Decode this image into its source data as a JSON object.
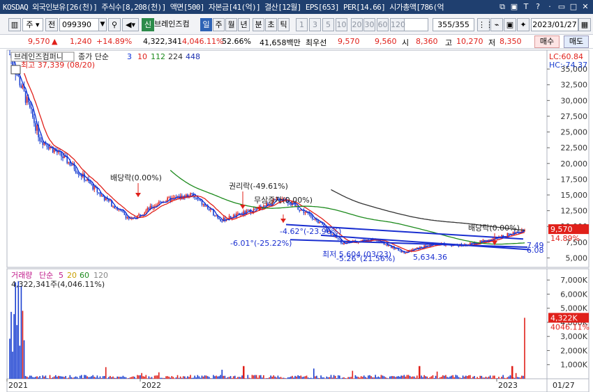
{
  "titlebar": {
    "text": "KOSDAQ 외국인보유[26(천)] 주식수[8,208(천)] 액면[500] 자본금[41(억)] 결산[12월] EPS[653] PER[14.66] 시가총액[786(억"
  },
  "toolbar": {
    "direction": "주",
    "mode": "전",
    "code": "099390",
    "company": "브레인즈컴",
    "periods": [
      "일",
      "주",
      "월",
      "년",
      "분",
      "초",
      "틱"
    ],
    "active_period": "일",
    "intervals": [
      "1",
      "3",
      "5",
      "10",
      "20",
      "30",
      "60",
      "120"
    ],
    "count": "355/355",
    "date": "2023/01/27"
  },
  "pricerow": {
    "price": "9,570",
    "change": "1,240",
    "change_pct": "+14.89%",
    "volume": "4,322,341",
    "volume_pct": "4,046.11%",
    "turnover_pct": "52.66%",
    "amount": "41,658백만",
    "priority_label": "최우선",
    "ask": "9,570",
    "bid": "9,560",
    "open_label": "시",
    "open": "8,360",
    "high_label": "고",
    "high": "10,270",
    "low_label": "저",
    "low": "8,350",
    "buy_label": "매수",
    "sell_label": "매도"
  },
  "price_panel": {
    "name_label": "브레인즈컴퍼니",
    "ma_label": "종가 단순",
    "ma_periods": [
      "3",
      "10",
      "112",
      "224",
      "448"
    ],
    "ma_colors": [
      "#0a2fd8",
      "#e0201a",
      "#1c8a1c",
      "#333333",
      "#1a2fb0"
    ],
    "high_marker": "최고 37,339 (08/20)",
    "lc": "LC:60.84",
    "hc": "HC:-74.37",
    "current_price_tag": "9,570",
    "current_pct_tag": "14.89%",
    "annotations": {
      "dividend1": "배당락(0.00%)",
      "rights": "권리락(-49.61%)",
      "capital_increase": "무상증자(0.00%)",
      "dividend2": "배당락(0.00%)",
      "trend1": "-4.62°(-23.96%)",
      "trend2": "-6.01°(-25.22%)",
      "low_marker": "최저 5,604 (03/23)",
      "trend3": "-5.26°(21.56%)",
      "low_price": "5,634.36",
      "end1": "7.49",
      "end2": "6.08"
    }
  },
  "volume_panel": {
    "label": "거래량",
    "ma_label": "단순",
    "ma_periods": [
      "5",
      "20",
      "60",
      "120"
    ],
    "ma_colors": [
      "#c0198a",
      "#c9a000",
      "#1c8a1c",
      "#888888"
    ],
    "value_label": "4,322,341주(4,046.11%)",
    "current_tag": "4,322K",
    "current_pct": "4046.11%"
  },
  "x_axis": {
    "labels": [
      "2021",
      "2022",
      "2023",
      "01/27"
    ]
  },
  "chart_data": [
    {
      "type": "candlestick",
      "title": "브레인즈컴퍼니",
      "ylim": [
        3500,
        38000
      ],
      "yticks": [
        5000,
        7500,
        10000,
        12500,
        15000,
        17500,
        20000,
        22500,
        25000,
        27500,
        30000,
        32500,
        35000
      ],
      "ytick_labels": [
        "5,000",
        "7,500",
        "10,000",
        "12,500",
        "15,000",
        "17,500",
        "20,000",
        "22,500",
        "25,000",
        "27,500",
        "30,000",
        "32,500",
        "35,000"
      ],
      "x": [
        "2020-08",
        "2020-09",
        "2020-10",
        "2020-11",
        "2020-12",
        "2021-02",
        "2021-04",
        "2021-06",
        "2021-08",
        "2021-10",
        "2021-12",
        "2022-02",
        "2022-04",
        "2022-06",
        "2022-08",
        "2022-10",
        "2022-12",
        "2023-01"
      ],
      "series": [
        {
          "name": "종가",
          "values": [
            37339,
            24000,
            20000,
            15000,
            11000,
            14000,
            15000,
            11000,
            12500,
            14500,
            11500,
            7300,
            8000,
            5900,
            7200,
            7000,
            8000,
            9570
          ]
        }
      ]
    },
    {
      "type": "bar",
      "title": "거래량",
      "ylim": [
        0,
        7600000
      ],
      "yticks": [
        1000000,
        2000000,
        3000000,
        4000000,
        5000000,
        6000000,
        7000000
      ],
      "ytick_labels": [
        "1,000K",
        "2,000K",
        "3,000K",
        "4,000K",
        "5,000K",
        "6,000K",
        "7,000K"
      ],
      "last_value": 4322341
    }
  ]
}
